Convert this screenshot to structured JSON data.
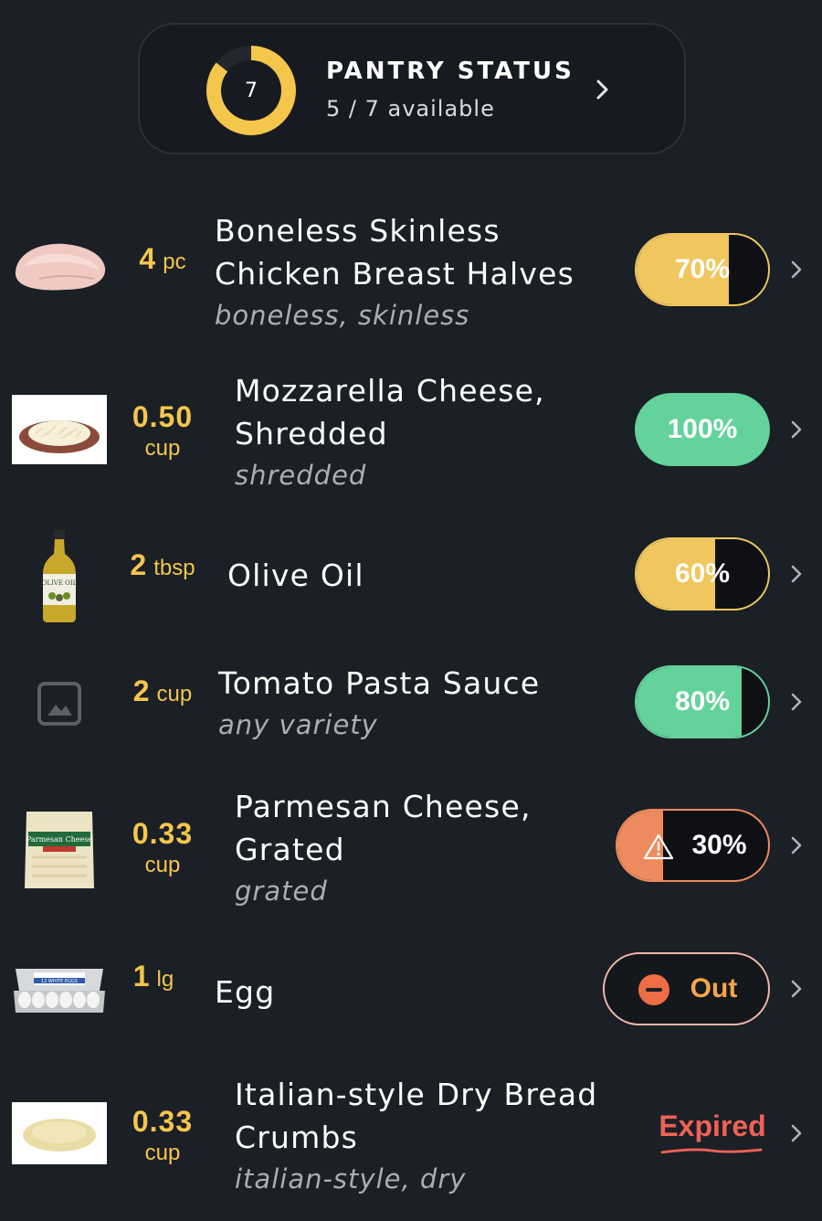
{
  "pantry_status": {
    "title": "PANTRY STATUS",
    "count": "7",
    "available_text": "5 / 7 available",
    "available": 5,
    "total": 7
  },
  "items": [
    {
      "name": "Boneless Skinless Chicken Breast Halves",
      "description": "boneless, skinless",
      "qty": "4",
      "unit": "pc",
      "status": "70%",
      "level": 0.7,
      "status_color": "#f0c75e",
      "image": "chicken-breast-image"
    },
    {
      "name": "Mozzarella Cheese, Shredded",
      "description": "shredded",
      "qty": "0.50",
      "unit": "cup",
      "status": "100%",
      "level": 1.0,
      "status_color": "#63d29b",
      "image": "mozzarella-image"
    },
    {
      "name": "Olive Oil",
      "description": "",
      "qty": "2",
      "unit": "tbsp",
      "status": "60%",
      "level": 0.6,
      "status_color": "#f0c75e",
      "image": "olive-oil-image"
    },
    {
      "name": "Tomato Pasta Sauce",
      "description": "any variety",
      "qty": "2",
      "unit": "cup",
      "status": "80%",
      "level": 0.8,
      "status_color": "#63d29b",
      "image": "image-placeholder-icon"
    },
    {
      "name": "Parmesan Cheese, Grated",
      "description": "grated",
      "qty": "0.33",
      "unit": "cup",
      "status": "30%",
      "level": 0.3,
      "status_color": "#ee8b5e",
      "status_icon": "warning-icon",
      "image": "parmesan-image"
    },
    {
      "name": "Egg",
      "description": "",
      "qty": "1",
      "unit": "lg",
      "status": "Out",
      "level": 0,
      "status_color": "#ee6d44",
      "status_icon": "minus-circle-icon",
      "image": "eggs-carton-image"
    },
    {
      "name": "Italian-style Dry Bread Crumbs",
      "description": "italian-style, dry",
      "qty": "0.33",
      "unit": "cup",
      "status": "Expired",
      "status_color": "#f06156",
      "image": "bread-crumbs-image"
    }
  ],
  "icons": {
    "chevron": "chevron-right-icon"
  },
  "colors": {
    "background": "#1b1f26",
    "qty": "#f4c64b",
    "ring": "#f4c64b"
  }
}
